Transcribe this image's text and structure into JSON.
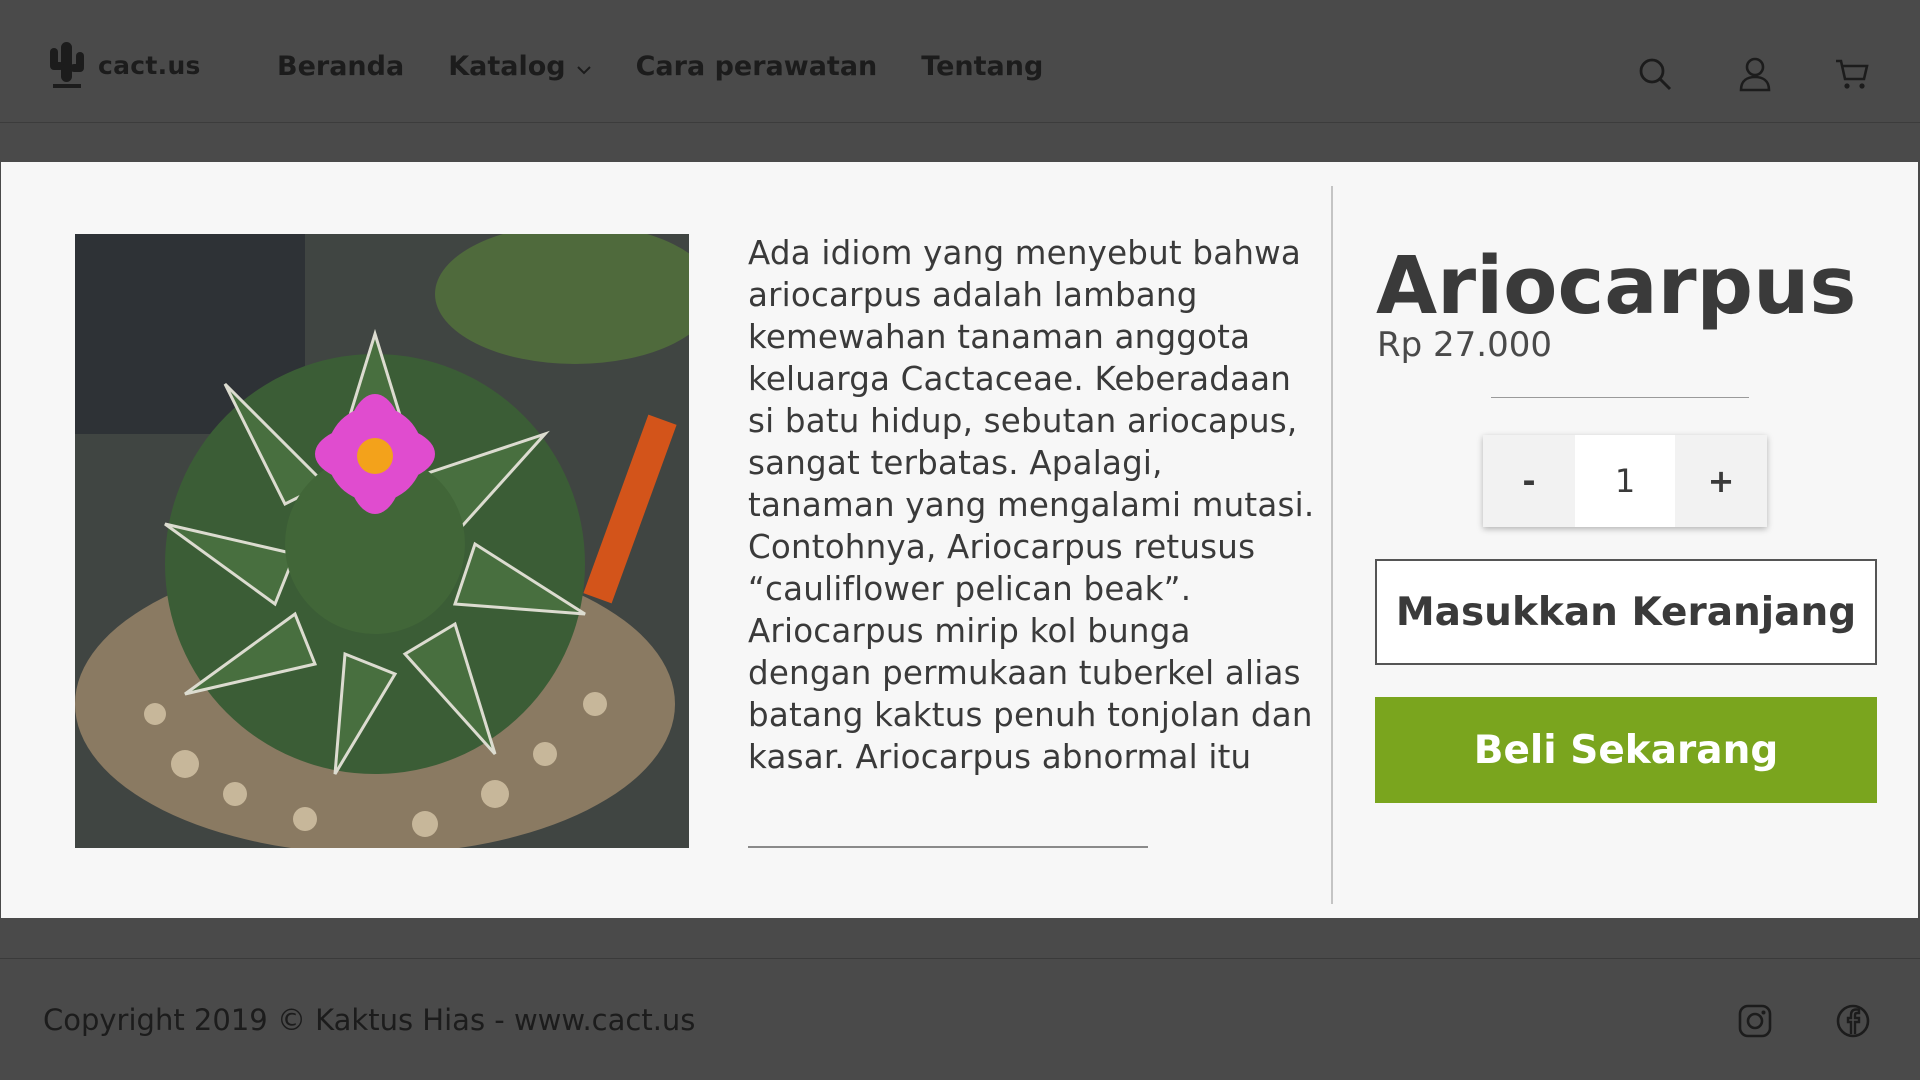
{
  "brand": {
    "name": "cact.us",
    "logo_icon": "cactus-icon"
  },
  "nav": {
    "items": [
      {
        "label": "Beranda"
      },
      {
        "label": "Katalog",
        "icon": "chevron-down-icon"
      },
      {
        "label": "Cara perawatan"
      },
      {
        "label": "Tentang"
      }
    ]
  },
  "header_icons": [
    "search-icon",
    "user-icon",
    "cart-icon"
  ],
  "product": {
    "image_description_icon": "cactus-photo",
    "description": "Ada idiom yang menyebut bahwa ariocarpus adalah lambang kemewahan tanaman anggota keluarga Cactaceae. Keberadaan si batu hidup, sebutan ariocapus, sangat terbatas. Apalagi, tanaman yang mengalami mutasi. Contohnya, Ariocarpus retusus “cauliflower pelican beak”. Ariocarpus mirip kol bunga dengan permukaan tuberkel alias batang kaktus penuh tonjolan dan kasar. Ariocarpus abnormal itu",
    "title": "Ariocarpus",
    "price": "Rp 27.000"
  },
  "quantity": {
    "minus_label": "-",
    "value": "1",
    "plus_label": "+"
  },
  "actions": {
    "add_to_cart_label": "Masukkan Keranjang",
    "buy_now_label": "Beli Sekarang",
    "buy_color": "#7aa51e"
  },
  "footer": {
    "copyright": "Copyright 2019 © Kaktus Hias - www.cact.us",
    "social_icons": [
      "instagram-icon",
      "facebook-icon"
    ]
  }
}
